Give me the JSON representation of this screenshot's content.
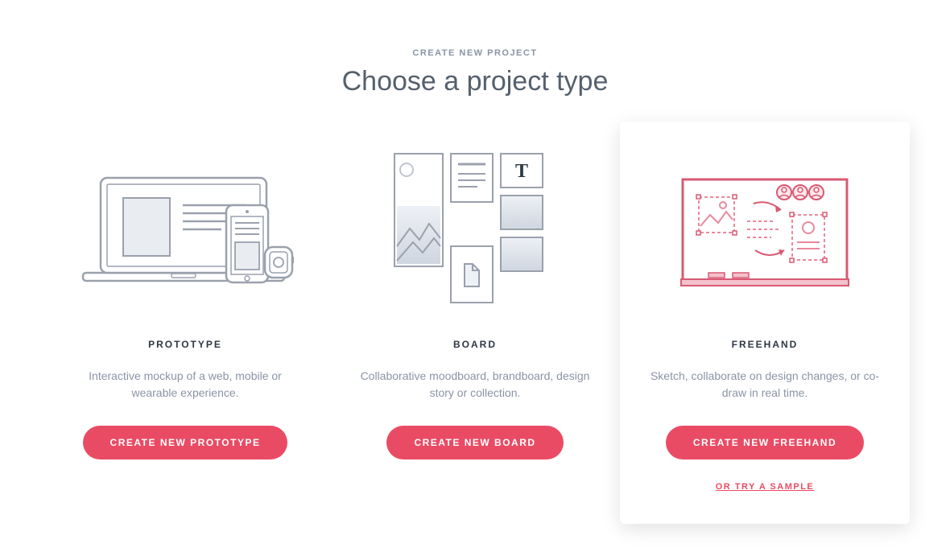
{
  "header": {
    "eyebrow": "CREATE NEW PROJECT",
    "title": "Choose a project type"
  },
  "cards": [
    {
      "label": "PROTOTYPE",
      "desc": "Interactive mockup of a web, mobile or wearable experience.",
      "button": "CREATE NEW PROTOTYPE"
    },
    {
      "label": "BOARD",
      "desc": "Collaborative moodboard, brandboard, design story or collection.",
      "button": "CREATE NEW BOARD"
    },
    {
      "label": "FREEHAND",
      "desc": "Sketch, collaborate on design changes, or co-draw in real time.",
      "button": "CREATE NEW FREEHAND",
      "sample": "OR TRY A SAMPLE"
    }
  ],
  "colors": {
    "accent": "#ea4b64",
    "textMuted": "#8a94a6",
    "textDark": "#2c3845",
    "title": "#55606e"
  }
}
